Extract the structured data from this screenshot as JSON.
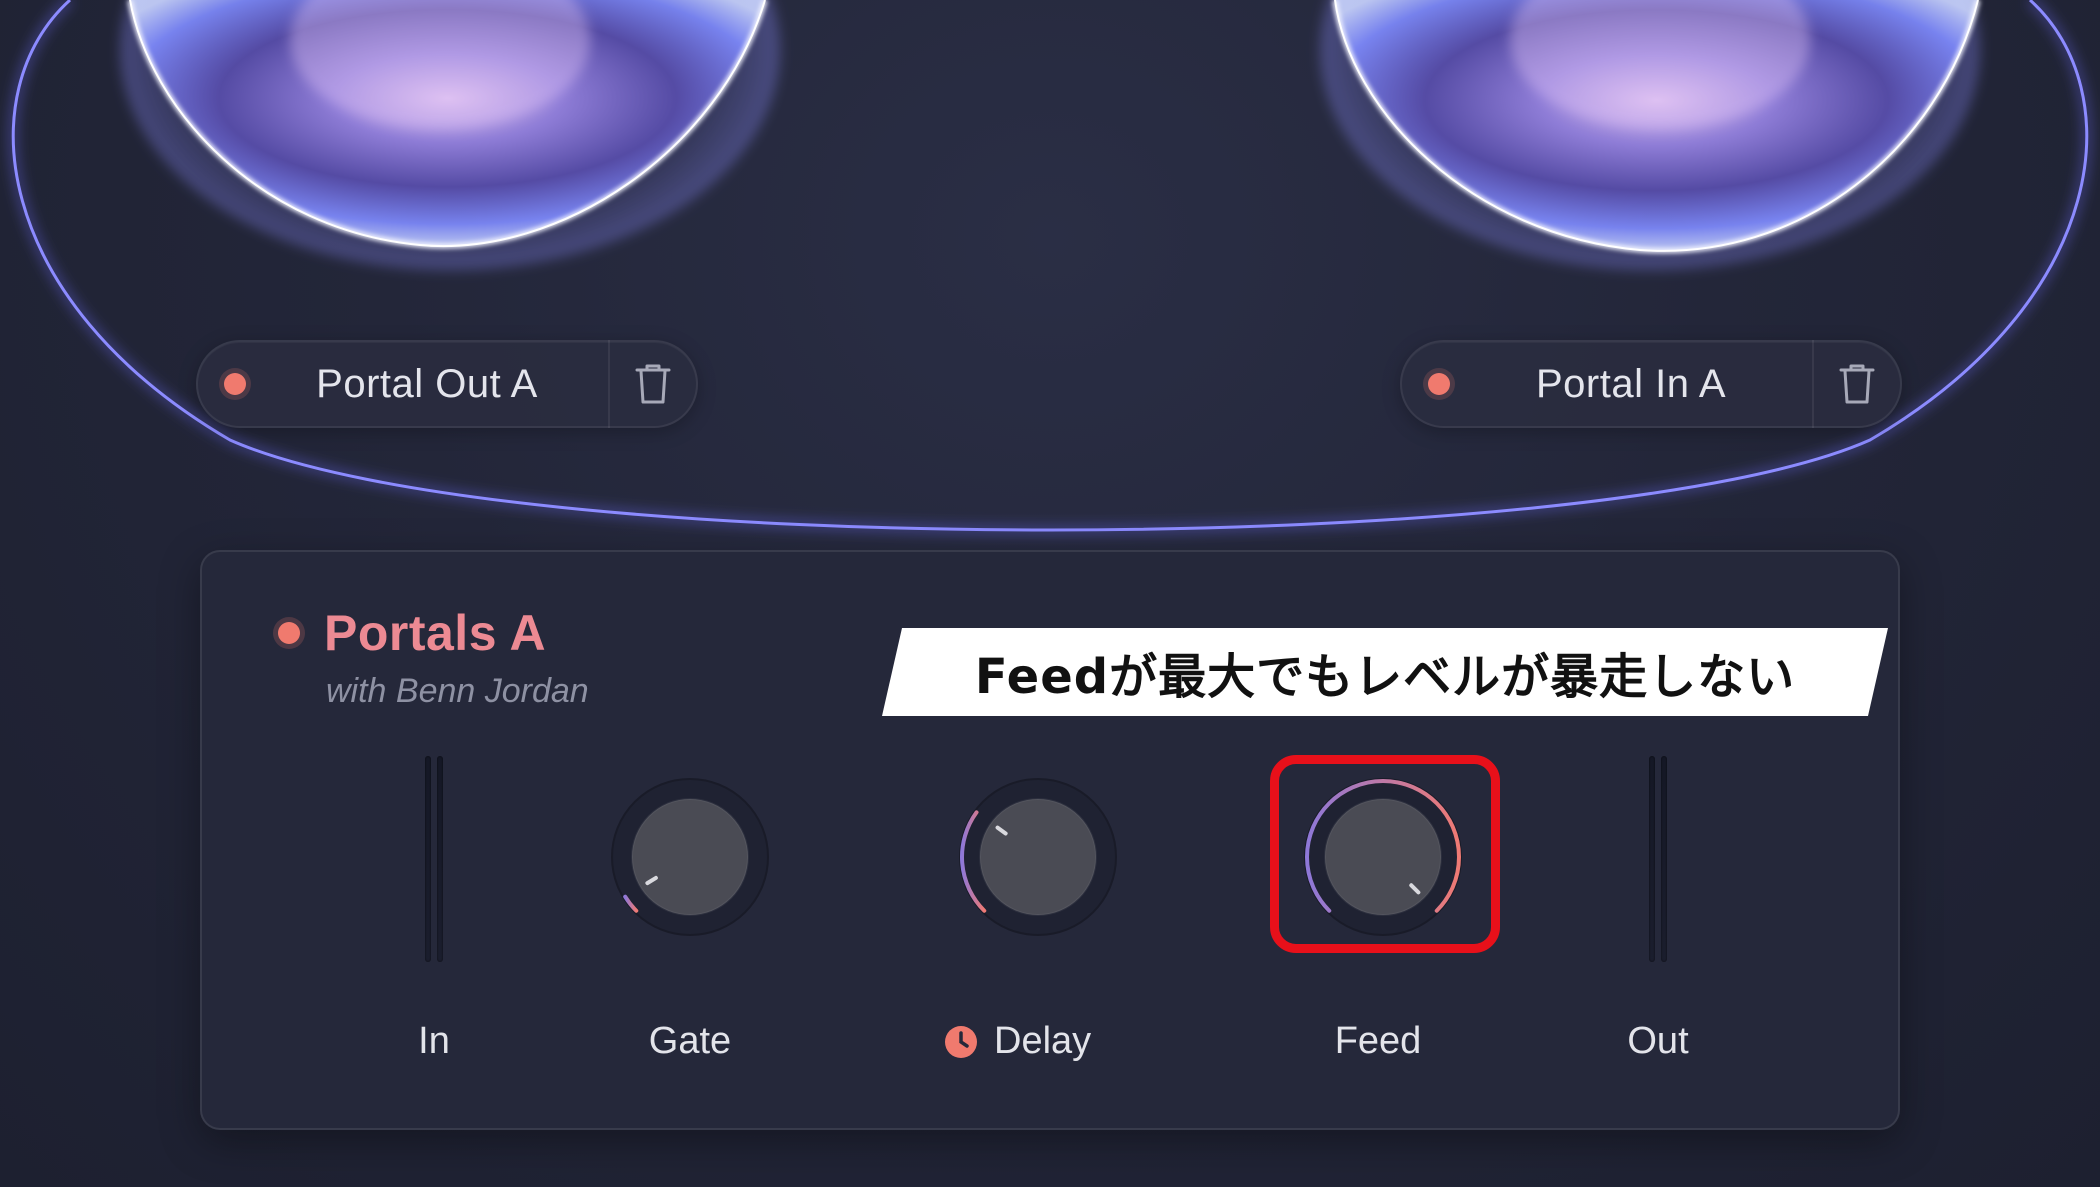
{
  "portals": {
    "out": {
      "label": "Portal Out A"
    },
    "in": {
      "label": "Portal In A"
    }
  },
  "panel": {
    "title": "Portals A",
    "subtitle": "with Benn Jordan"
  },
  "annotation": {
    "text": "Feedが最大でもレベルが暴走しない"
  },
  "controls": {
    "in": {
      "label": "In"
    },
    "gate": {
      "label": "Gate",
      "value": 0.05
    },
    "delay": {
      "label": "Delay",
      "value": 0.3,
      "sync_icon": "clock-icon"
    },
    "feed": {
      "label": "Feed",
      "value": 1.0
    },
    "out": {
      "label": "Out"
    }
  },
  "colors": {
    "accent_dot": "#f07a6e",
    "title": "#ec8a93",
    "arc_start": "#8e78d8",
    "arc_end": "#ef7a74",
    "highlight": "#e8101a",
    "orbit": "#6d6cff"
  }
}
